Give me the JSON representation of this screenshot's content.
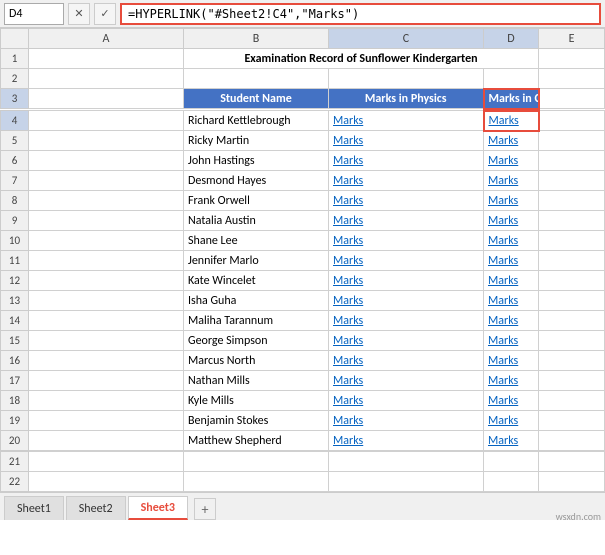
{
  "namebox": {
    "value": "D4"
  },
  "formulabar": {
    "value": "=HYPERLINK(\"#Sheet2!C4\",\"Marks\")"
  },
  "title": "Examination Record of Sunflower Kindergarten",
  "headers": {
    "student_name": "Student Name",
    "physics": "Marks in Physics",
    "chemistry": "Marks in Chemistry"
  },
  "students": [
    "Richard Kettlebrough",
    "Ricky Martin",
    "John Hastings",
    "Desmond Hayes",
    "Frank Orwell",
    "Natalia Austin",
    "Shane Lee",
    "Jennifer Marlo",
    "Kate Wincelet",
    "Isha Guha",
    "Maliha Tarannum",
    "George Simpson",
    "Marcus North",
    "Nathan Mills",
    "Kyle Mills",
    "Benjamin Stokes",
    "Matthew Shepherd"
  ],
  "marks_label": "Marks",
  "columns": {
    "A": "A",
    "B": "B",
    "C": "C",
    "D": "D",
    "E": "E"
  },
  "tabs": {
    "sheet1": "Sheet1",
    "sheet2": "Sheet2",
    "sheet3": "Sheet3"
  }
}
